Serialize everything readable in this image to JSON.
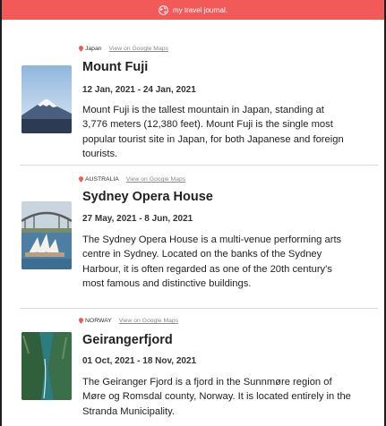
{
  "header": {
    "title": "my travel journal.",
    "bg_color": "#f25959",
    "icon": "globe-icon"
  },
  "entries": [
    {
      "country": "Japan",
      "maps_link": "View on Google Maps",
      "title": "Mount Fuji",
      "dates": "12 Jan, 2021 - 24 Jan, 2021",
      "description": "Mount Fuji is the tallest mountain in Japan, standing at 3,776 meters (12,380 feet). Mount Fuji is the single most popular tourist site in Japan, for both Japanese and foreign tourists."
    },
    {
      "country": "AUSTRALIA",
      "maps_link": "View on Google Maps",
      "title": "Sydney Opera House",
      "dates": "27 May, 2021 - 8 Jun, 2021",
      "description": "The Sydney Opera House is a multi-venue performing arts centre in Sydney. Located on the banks of the Sydney Harbour, it is often regarded as one of the 20th century's most famous and distinctive buildings."
    },
    {
      "country": "NORWAY",
      "maps_link": "View on Google Maps",
      "title": "Geirangerfjord",
      "dates": "01 Oct, 2021 - 18 Nov, 2021",
      "description": "The Geiranger Fjord is a fjord in the Sunnmøre region of Møre og Romsdal county, Norway. It is located entirely in the Stranda Municipality."
    }
  ]
}
